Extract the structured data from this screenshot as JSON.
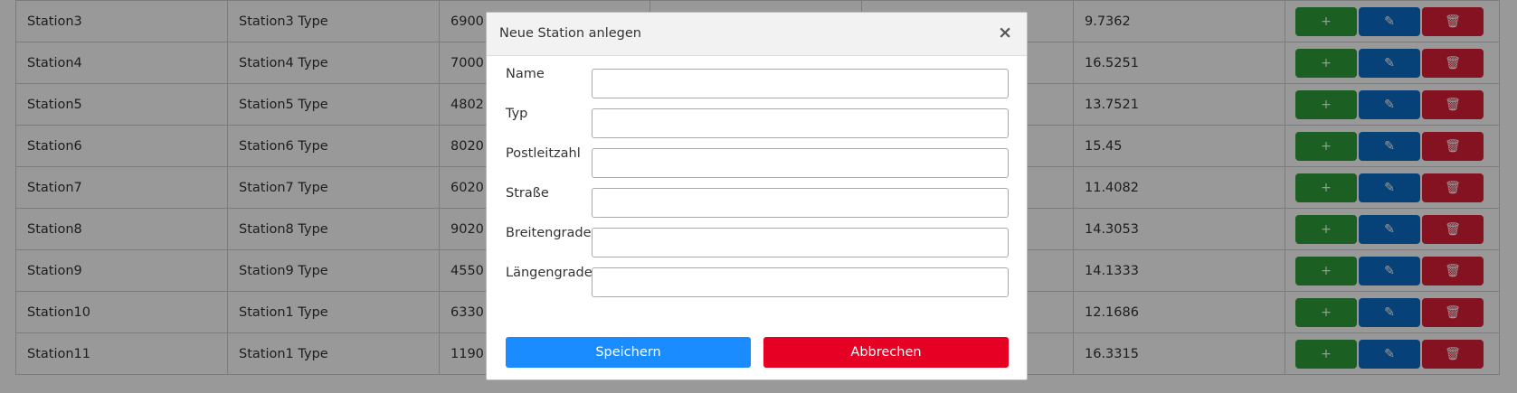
{
  "table": {
    "rows": [
      {
        "name": "Station3",
        "type": "Station3 Type",
        "plz": "6900",
        "lng": "9.7362"
      },
      {
        "name": "Station4",
        "type": "Station4 Type",
        "plz": "7000",
        "lng": "16.5251"
      },
      {
        "name": "Station5",
        "type": "Station5 Type",
        "plz": "4802",
        "lng": "13.7521"
      },
      {
        "name": "Station6",
        "type": "Station6 Type",
        "plz": "8020",
        "lng": "15.45"
      },
      {
        "name": "Station7",
        "type": "Station7 Type",
        "plz": "6020",
        "lng": "11.4082"
      },
      {
        "name": "Station8",
        "type": "Station8 Type",
        "plz": "9020",
        "lng": "14.3053"
      },
      {
        "name": "Station9",
        "type": "Station9 Type",
        "plz": "4550",
        "lng": "14.1333"
      },
      {
        "name": "Station10",
        "type": "Station1 Type",
        "plz": "6330",
        "lng": "12.1686"
      },
      {
        "name": "Station11",
        "type": "Station1 Type",
        "plz": "1190",
        "lng": "16.3315"
      }
    ],
    "action_icons": {
      "add": "+",
      "edit": "✎",
      "delete": "🗑"
    }
  },
  "modal": {
    "title": "Neue Station anlegen",
    "close_glyph": "×",
    "fields": [
      {
        "label": "Name",
        "value": ""
      },
      {
        "label": "Typ",
        "value": ""
      },
      {
        "label": "Postleitzahl",
        "value": ""
      },
      {
        "label": "Straße",
        "value": ""
      },
      {
        "label": "Breitengrade",
        "value": ""
      },
      {
        "label": "Längengrade",
        "value": ""
      }
    ],
    "save_label": "Speichern",
    "cancel_label": "Abbrechen"
  },
  "colors": {
    "add": "#2f9e3b",
    "edit": "#0b6fc7",
    "delete": "#dd1f36",
    "primary": "#1a8cff",
    "danger": "#e60023"
  }
}
